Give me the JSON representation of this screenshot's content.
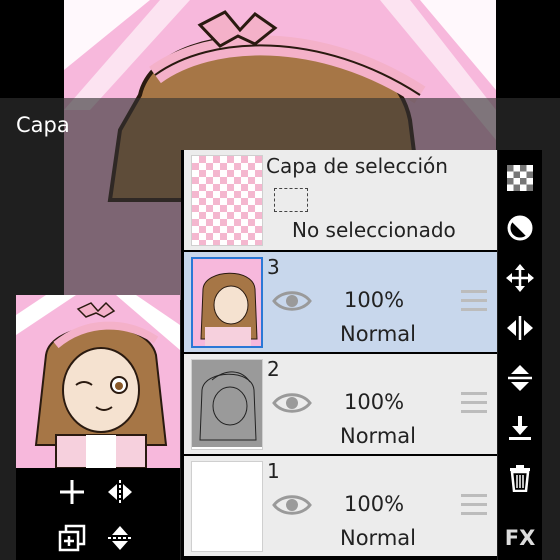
{
  "panel": {
    "title": "Capa"
  },
  "selection_layer": {
    "title": "Capa de selección",
    "status": "No seleccionado"
  },
  "layers": [
    {
      "number": "3",
      "opacity": "100%",
      "blend": "Normal",
      "active": true
    },
    {
      "number": "2",
      "opacity": "100%",
      "blend": "Normal",
      "active": false
    },
    {
      "number": "1",
      "opacity": "100%",
      "blend": "Normal",
      "active": false
    }
  ],
  "right_toolbar": {
    "icons": [
      "checkerboard-icon",
      "half-circle-icon",
      "move-arrows-icon",
      "flip-horizontal-icon",
      "flip-vertical-icon",
      "merge-down-icon",
      "trash-icon",
      "fx-icon"
    ],
    "fx_label": "FX"
  },
  "left_toolbar": {
    "icons": [
      "add-layer-icon",
      "flip-horizontal-icon",
      "duplicate-layer-icon",
      "flip-vertical-icon"
    ]
  },
  "colors": {
    "canvas_pink": "#f7b8dc",
    "active_layer": "#c8d7ec",
    "row_background": "#ececec",
    "accent_border": "#2a78d6"
  }
}
